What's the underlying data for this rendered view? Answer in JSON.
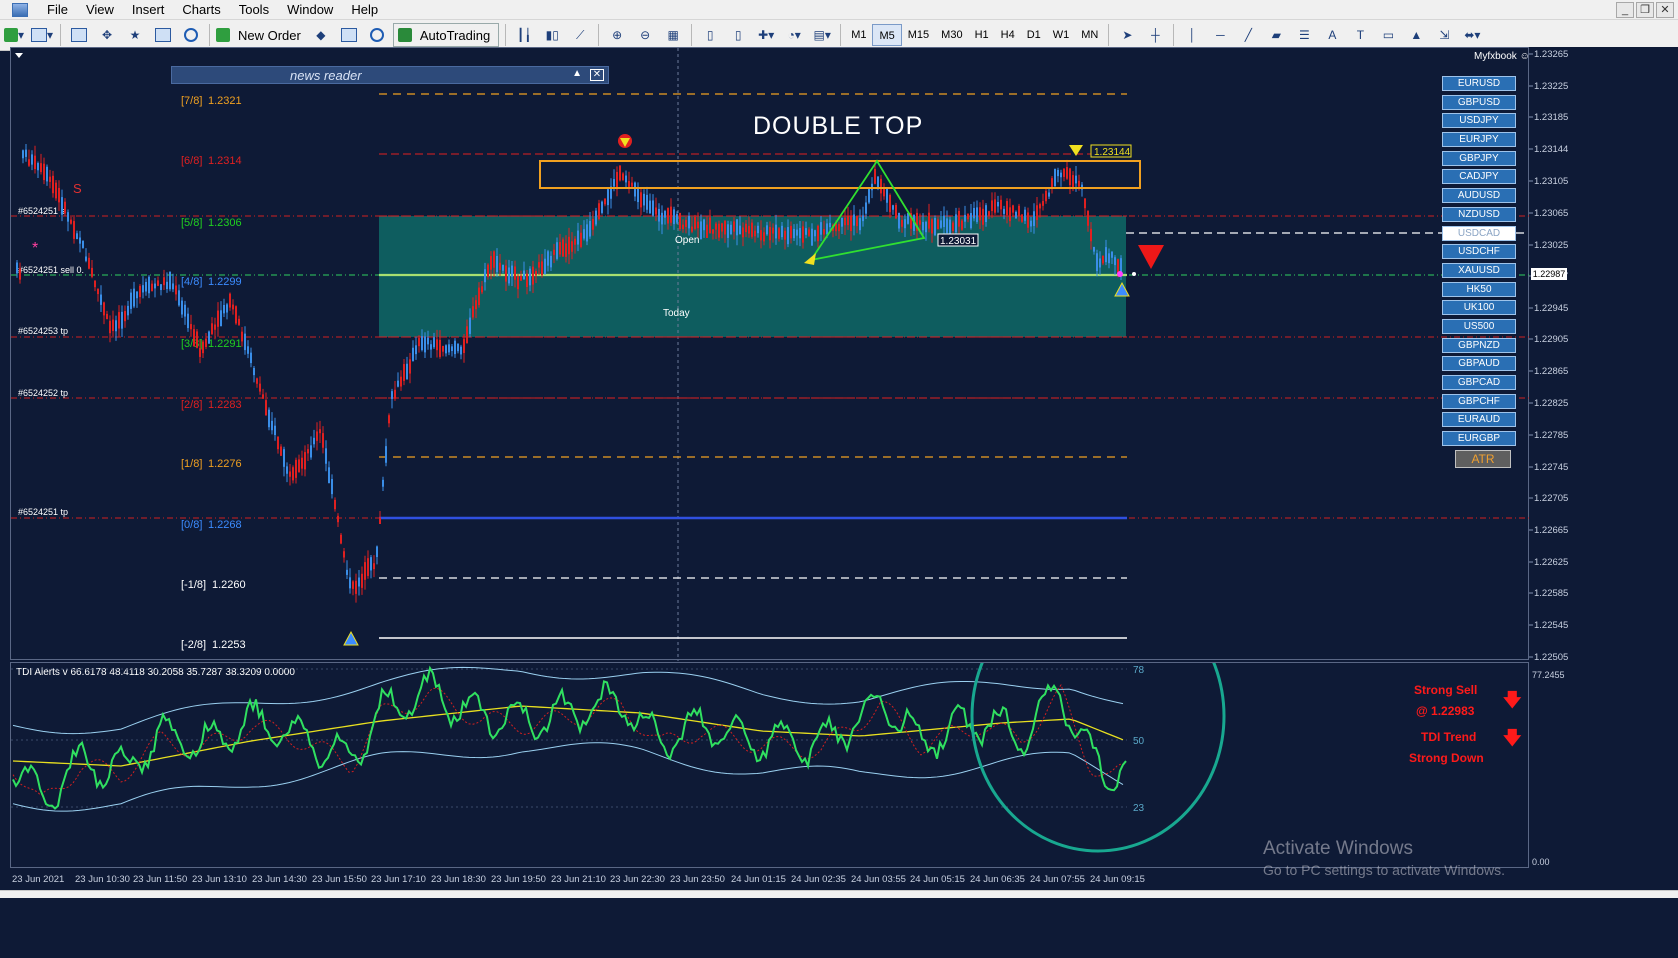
{
  "menu": {
    "items": [
      "File",
      "View",
      "Insert",
      "Charts",
      "Tools",
      "Window",
      "Help"
    ]
  },
  "toolbar": {
    "new_order_label": "New Order",
    "autotrading_label": "AutoTrading",
    "timeframes": [
      "M1",
      "M5",
      "M15",
      "M30",
      "H1",
      "H4",
      "D1",
      "W1",
      "MN"
    ],
    "active_timeframe": "M5"
  },
  "news_reader": {
    "title": "news reader"
  },
  "chart": {
    "annotation_title": "DOUBLE TOP",
    "open_label": "Open",
    "today_label": "Today",
    "peak_price_label": "1.23144",
    "neckline_price_label": "1.23031",
    "watermark": "Myfxbook",
    "murrey_levels": [
      {
        "label": "[7/8]",
        "price": "1.2321",
        "color": "#f0a020"
      },
      {
        "label": "[6/8]",
        "price": "1.2314",
        "color": "#e02020"
      },
      {
        "label": "[5/8]",
        "price": "1.2306",
        "color": "#20d020"
      },
      {
        "label": "[4/8]",
        "price": "1.2299",
        "color": "#3c8cff"
      },
      {
        "label": "[3/8]",
        "price": "1.2291",
        "color": "#20d020"
      },
      {
        "label": "[2/8]",
        "price": "1.2283",
        "color": "#e02020"
      },
      {
        "label": "[1/8]",
        "price": "1.2276",
        "color": "#f0a020"
      },
      {
        "label": "[0/8]",
        "price": "1.2268",
        "color": "#3c8cff"
      },
      {
        "label": "[-1/8]",
        "price": "1.2260",
        "color": "#ffffff"
      },
      {
        "label": "[-2/8]",
        "price": "1.2253",
        "color": "#ffffff"
      }
    ],
    "order_labels": [
      "#6524251 s",
      "#6524251 sell 0.",
      "#6524253 tp",
      "#6524252 tp",
      "#6524251 tp"
    ],
    "s_marker": "S"
  },
  "price_axis": {
    "ticks": [
      "1.23265",
      "1.23225",
      "1.23185",
      "1.23144",
      "1.23105",
      "1.23065",
      "1.23025",
      "1.22987",
      "1.22945",
      "1.22905",
      "1.22865",
      "1.22825",
      "1.22785",
      "1.22745",
      "1.22705",
      "1.22665",
      "1.22625",
      "1.22585",
      "1.22545",
      "1.22505"
    ],
    "current_price": "1.22987"
  },
  "symbols": [
    "EURUSD",
    "GBPUSD",
    "USDJPY",
    "EURJPY",
    "GBPJPY",
    "CADJPY",
    "AUDUSD",
    "NZDUSD",
    "USDCAD",
    "USDCHF",
    "XAUUSD",
    "HK50",
    "UK100",
    "US500",
    "GBPNZD",
    "GBPAUD",
    "GBPCAD",
    "GBPCHF",
    "EURAUD",
    "EURGBP"
  ],
  "selected_symbol": "USDCAD",
  "atr_label": "ATR",
  "tdi": {
    "header": "TDI Alerts v 66.6178 48.4118 30.2058 35.7287 38.3209 0.0000",
    "level_78": "78",
    "level_50": "50",
    "level_23": "23",
    "scale_top": "77.2455",
    "scale_bottom": "0.00",
    "signal_1_line1": "Strong Sell",
    "signal_1_line2": "@ 1.22983",
    "signal_2_line1": "TDI Trend",
    "signal_2_line2": "Strong Down"
  },
  "time_axis": {
    "labels": [
      "23 Jun 2021",
      "23 Jun 10:30",
      "23 Jun 11:50",
      "23 Jun 13:10",
      "23 Jun 14:30",
      "23 Jun 15:50",
      "23 Jun 17:10",
      "23 Jun 18:30",
      "23 Jun 19:50",
      "23 Jun 21:10",
      "23 Jun 22:30",
      "23 Jun 23:50",
      "24 Jun 01:15",
      "24 Jun 02:35",
      "24 Jun 03:55",
      "24 Jun 05:15",
      "24 Jun 06:35",
      "24 Jun 07:55",
      "24 Jun 09:15"
    ]
  },
  "activate_windows": {
    "line1": "Activate Windows",
    "line2": "Go to PC settings to activate Windows."
  }
}
